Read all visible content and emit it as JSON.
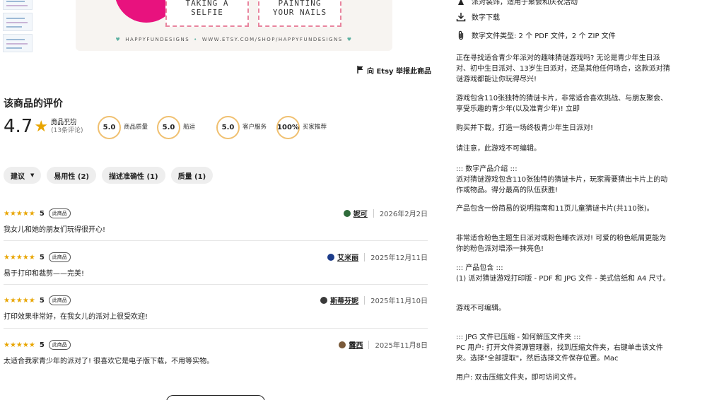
{
  "hero": {
    "card1_line1": "TAKING A",
    "card1_line2": "SELFIE",
    "card2_line1": "PAINTING",
    "card2_line2": "YOUR NAILS",
    "brand_name": "HAPPYFUNDESIGNS",
    "brand_url": "WWW.ETSY.COM/SHOP/HAPPYFUNDESIGNS"
  },
  "report_link": "向 Etsy 举报此商品",
  "reviews_section": {
    "title": "该商品的评价",
    "average": "4.7",
    "average_label": "商品平均",
    "review_count": "(13条评论)",
    "metrics": [
      {
        "value": "5.0",
        "label": "商品质量"
      },
      {
        "value": "5.0",
        "label": "船运"
      },
      {
        "value": "5.0",
        "label": "客户服务"
      },
      {
        "value": "100%",
        "label": "买家推荐"
      }
    ],
    "filters": [
      {
        "label": "建议"
      },
      {
        "label": "易用性 (2)"
      },
      {
        "label": "描述准确性 (1)"
      },
      {
        "label": "质量 (1)"
      }
    ],
    "items": [
      {
        "rating": "5",
        "tag": "此商品",
        "author": "妮可",
        "date": "2026年2月2日",
        "text": "我女儿和她的朋友们玩得很开心!",
        "avatar_color": "#2f6b3a"
      },
      {
        "rating": "5",
        "tag": "此商品",
        "author": "艾米丽",
        "date": "2025年12月11日",
        "text": "易于打印和裁剪——完美!",
        "avatar_color": "#1c3c8a"
      },
      {
        "rating": "5",
        "tag": "此商品",
        "author": "斯蒂芬妮",
        "date": "2025年11月10日",
        "text": "打印效果非常好，在我女儿的派对上很受欢迎!",
        "avatar_color": "#3a3a3a"
      },
      {
        "rating": "5",
        "tag": "此商品",
        "author": "露西",
        "date": "2025年11月8日",
        "text": "太适合我家青少年的派对了! 很喜欢它是电子版下载，不用等实物。",
        "avatar_color": "#7a5a3a"
      }
    ]
  },
  "details": {
    "feature_partial": "派对装饰，适用于聚会和庆祝活动",
    "feature_download": "数字下载",
    "feature_filetype": "数字文件类型: 2 个 PDF 文件，2 个 ZIP 文件"
  },
  "description": [
    "正在寻找适合青少年派对的趣味猜谜游戏吗? 无论是青少年生日派对、初中生日派对、13岁生日派对，还是其他任何场合，这款派对猜谜游戏都能让你玩得尽兴!",
    "游戏包含110张独特的猜谜卡片，非常适合喜欢挑战、与朋友聚会、享受乐趣的青少年(以及准青少年)! 立即",
    "购买并下载，打造一场终极青少年生日派对!",
    "请注意，此游戏不可编辑。",
    "::: 数字产品介绍 :::\n派对猜谜游戏包含110张独特的猜谜卡片，玩家需要猜出卡片上的动作或物品。得分最高的队伍获胜!",
    "产品包含一份简易的说明指南和11页儿童猜谜卡片(共110张)。",
    "非常适合粉色主题生日派对或粉色睡衣派对! 可爱的粉色纸屑更能为你的粉色派对增添一抹亮色!",
    "::: 产品包含 :::\n(1) 派对猜谜游戏打印版 - PDF 和 JPG 文件 - 美式信纸和 A4 尺寸。",
    "游戏不可编辑。",
    "::: JPG 文件已压缩 - 如何解压文件夹 :::\nPC 用户: 打开文件资源管理器，找到压缩文件夹，右键单击该文件夹。选择\"全部提取\"，然后选择文件保存位置。Mac",
    "用户: 双击压缩文件夹，即可访问文件。"
  ],
  "colors": {
    "star": "#e8a500",
    "metric_ring": "#f0c070",
    "hero_pink": "#e8127e"
  }
}
